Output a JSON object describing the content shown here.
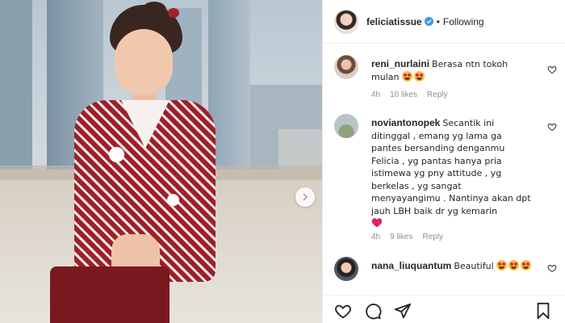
{
  "header": {
    "username": "feliciatissue",
    "separator": "•",
    "follow_status": "Following"
  },
  "comments": [
    {
      "username": "reni_nurlaini",
      "text": "Berasa ntn tokoh mulan",
      "emojis": [
        "heart-eyes",
        "heart-eyes"
      ],
      "time": "4h",
      "likes": "10 likes",
      "reply": "Reply"
    },
    {
      "username": "noviantonopek",
      "text": "Secantik ini ditinggal , emang yg lama ga pantes bersanding denganmu Felicia , yg pantas hanya pria istimewa yg pny attitude , yg berkelas , yg sangat menyayangimu . Nantinya akan dpt jauh LBH baik dr yg kemarin",
      "emojis": [
        "red-heart"
      ],
      "time": "4h",
      "likes": "9 likes",
      "reply": "Reply"
    },
    {
      "username": "nana_liuquantum",
      "text": "Beautiful",
      "emojis": [
        "heart-eyes",
        "heart-eyes",
        "heart-eyes"
      ]
    }
  ],
  "colors": {
    "verified": "#3897f0",
    "heart": "#ed4956",
    "meta": "#8e8e8e"
  }
}
